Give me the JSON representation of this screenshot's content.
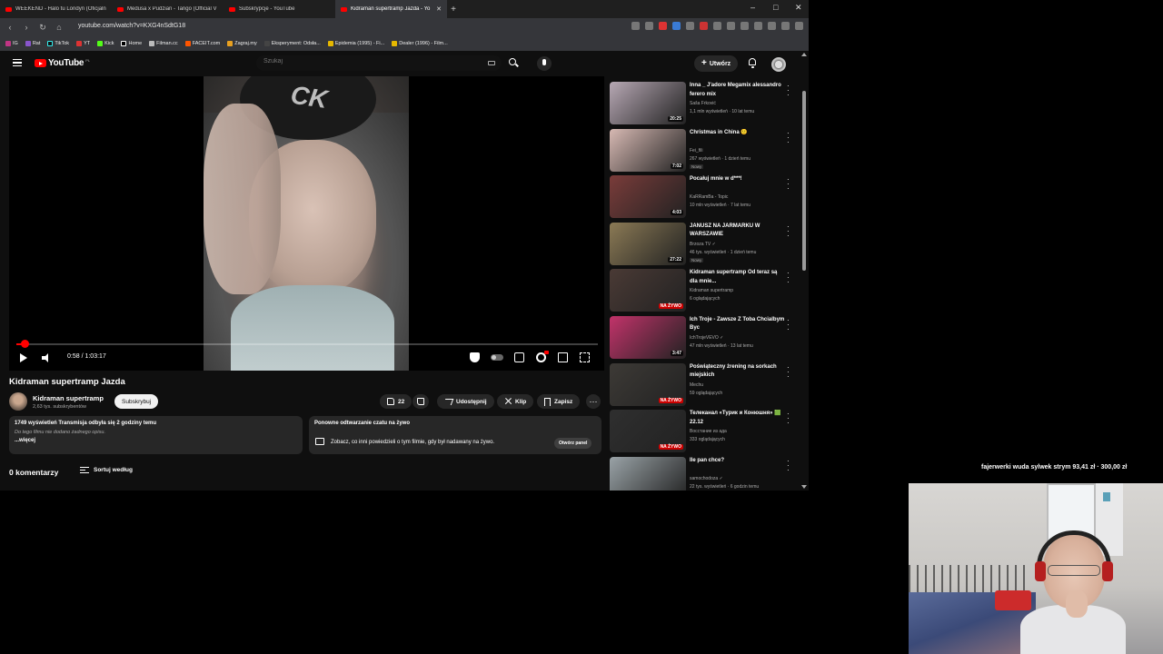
{
  "browser": {
    "tabs": [
      {
        "label": "WEEKEND - Halo tu Londyn (Oficjaln",
        "active": false
      },
      {
        "label": "Medusa x Pudzian - Tango (Official V",
        "active": false
      },
      {
        "label": "Subskrypcje - YouTube",
        "active": false
      },
      {
        "label": "Kidraman supertramp Jazda - Yo",
        "active": true
      }
    ],
    "new_tab": "+",
    "window_controls": {
      "minimize": "–",
      "maximize": "□",
      "close": "✕"
    },
    "url": "youtube.com/watch?v=KXG4nSdtG18",
    "bookmarks": [
      "IG",
      "Rat",
      "TikTok",
      "YT",
      "Kick",
      "Home",
      "Filman.cc",
      "FACEIT.com",
      "Zagraj.my",
      "Eksperyment: Odsła...",
      "Epidemia (1995) - Fi...",
      "Dealer (1996) - Film..."
    ]
  },
  "youtube": {
    "logo_text": "YouTube",
    "logo_region": "PL",
    "search_placeholder": "Szukaj",
    "create_label": "Utwórz",
    "player": {
      "time": "0:58 / 1:03:17",
      "progress": 0.015
    },
    "video": {
      "title": "Kidraman supertramp Jazda",
      "channel": "Kidraman supertramp",
      "subscribers": "2,63 tys. subskrybentów",
      "subscribe_label": "Subskrybuj",
      "likes": "22",
      "share_label": "Udostępnij",
      "clip_label": "Klip",
      "save_label": "Zapisz",
      "more": "⋯"
    },
    "description": {
      "stats": "1749 wyświetleń  Transmisja odbyła się 2 godziny temu",
      "empty": "Do tego filmu nie dodano żadnego opisu.",
      "more": "...więcej"
    },
    "chat_replay": {
      "title": "Ponowne odtwarzanie czatu na żywo",
      "text": "Zobacz, co inni powiedzieli o tym filmie, gdy był nadawany na żywo.",
      "button": "Otwórz panel"
    },
    "comments": {
      "count_label": "0 komentarzy",
      "sort_label": "Sortuj według"
    },
    "recommendations": [
      {
        "title": "Inna _ J'adore Megamix alessandro ferero mix",
        "channel": "Saša Frković",
        "meta": "1,1 mln wyświetleń · 10 lat temu",
        "duration": "20:25",
        "live": false,
        "badge": "",
        "bg": "#b7a8b4"
      },
      {
        "title": "Christmas in China 🙂",
        "channel": "Fei_fili",
        "meta": "267 wyświetleń · 1 dzień temu",
        "duration": "7:02",
        "live": false,
        "badge": "Nowy",
        "bg": "#d7b9b3"
      },
      {
        "title": "Pocałuj mnie w d***!",
        "channel": "KaRRamBa - Topic",
        "meta": "10 mln wyświetleń · 7 lat temu",
        "duration": "4:03",
        "live": false,
        "badge": "",
        "bg": "#7a3c3a"
      },
      {
        "title": "JANUSZ NA JARMARKU W WARSZAWIE",
        "channel": "Brzoza TV ✓",
        "meta": "46 tys. wyświetleń · 1 dzień temu",
        "duration": "27:22",
        "live": false,
        "badge": "Nowy",
        "bg": "#8b7a55"
      },
      {
        "title": "Kidraman supertramp Od teraz są dla mnie...",
        "channel": "Kidraman supertramp",
        "meta": "6 oglądających",
        "duration": "NA ŻYWO",
        "live": true,
        "badge": "",
        "bg": "#4a3a35"
      },
      {
        "title": "Ich Troje - Zawsze Z Toba Chcialbym Byc",
        "channel": "IchTrojeVEVO ✓",
        "meta": "47 mln wyświetleń · 13 lat temu",
        "duration": "3:47",
        "live": false,
        "badge": "",
        "bg": "#c2336a"
      },
      {
        "title": "Poświąteczny żrening na sorkach miejskich",
        "channel": "Mechu",
        "meta": "59 oglądających",
        "duration": "NA ŻYWO",
        "live": true,
        "badge": "",
        "bg": "#3d3a36"
      },
      {
        "title": "Телеканал «Турик и Конюшня» 🟩 22.12",
        "channel": "Восстание из ада",
        "meta": "333 oglądających",
        "duration": "NA ŻYWO",
        "live": true,
        "badge": "",
        "bg": "#2f2f2f"
      },
      {
        "title": "Ile pan chce?",
        "channel": "samochodoza ✓",
        "meta": "22 tys. wyświetleń · 6 godzin temu",
        "duration": "",
        "live": false,
        "badge": "",
        "bg": "#9aa3a7"
      }
    ]
  },
  "overlay": {
    "donation_text": "fajerwerki wuda sylwek strym  93,41 zł  ·  300,00 zł"
  },
  "colors": {
    "accent": "#ff0000",
    "page_bg": "#0f0f0f",
    "pill_bg": "#272727"
  }
}
